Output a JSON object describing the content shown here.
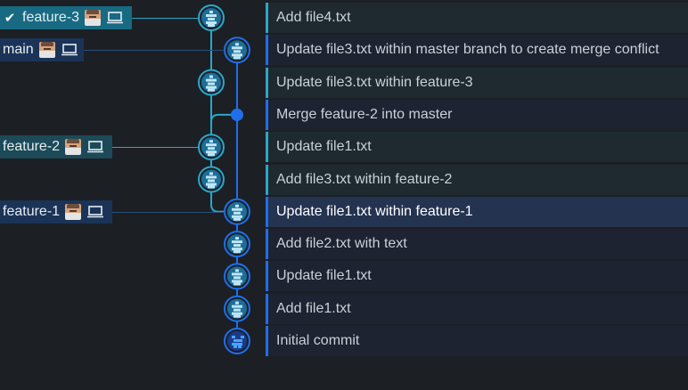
{
  "colors": {
    "background": "#1c1f24",
    "lane_teal": "#2aa7c9",
    "lane_blue": "#1f6feb",
    "selected_row": "#243350",
    "commit_node": "#2f9fd6"
  },
  "branches": [
    {
      "label": "feature-3",
      "current": true,
      "check_icon": "check-icon",
      "avatar_icon": "avatar",
      "laptop_icon": "laptop-icon"
    },
    {
      "label": "main",
      "current": false,
      "avatar_icon": "avatar",
      "laptop_icon": "laptop-icon"
    },
    {
      "label": "feature-2",
      "current": false,
      "avatar_icon": "avatar",
      "laptop_icon": "laptop-icon"
    },
    {
      "label": "feature-1",
      "current": false,
      "avatar_icon": "avatar",
      "laptop_icon": "laptop-icon"
    }
  ],
  "commits": [
    {
      "message": "Add file4.txt",
      "lane": "teal"
    },
    {
      "message": "Update file3.txt within master branch to create merge conflict",
      "lane": "blue"
    },
    {
      "message": "Update file3.txt within feature-3",
      "lane": "teal"
    },
    {
      "message": "Merge feature-2 into master",
      "lane": "blue",
      "merge": true
    },
    {
      "message": "Update file1.txt",
      "lane": "teal"
    },
    {
      "message": "Add file3.txt within feature-2",
      "lane": "teal"
    },
    {
      "message": "Update file1.txt within feature-1",
      "lane": "blue",
      "selected": true
    },
    {
      "message": "Add file2.txt with text",
      "lane": "blue"
    },
    {
      "message": "Update file1.txt",
      "lane": "blue"
    },
    {
      "message": "Add file1.txt",
      "lane": "blue"
    },
    {
      "message": "Initial commit",
      "lane": "blue",
      "root": true
    }
  ]
}
